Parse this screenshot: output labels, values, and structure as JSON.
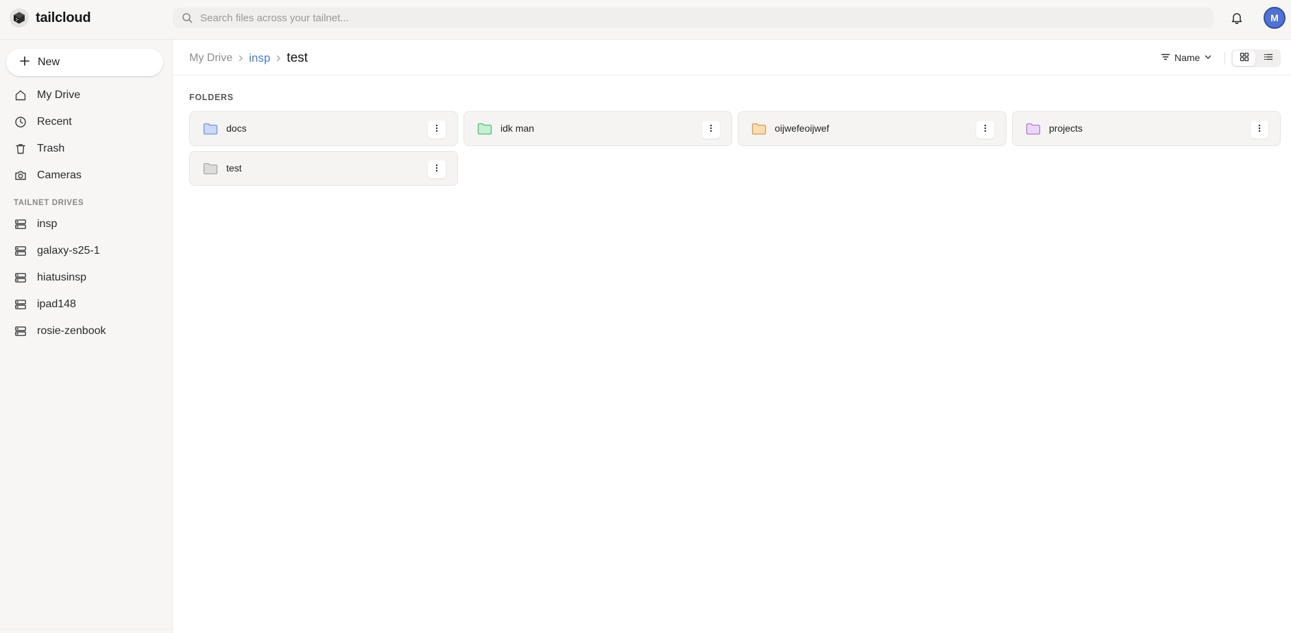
{
  "app": {
    "name": "tailcloud"
  },
  "search": {
    "placeholder": "Search files across your tailnet..."
  },
  "user": {
    "avatar_initial": "M",
    "avatar_color": "#4f72d6"
  },
  "sidebar": {
    "new_label": "New",
    "nav": [
      {
        "label": "My Drive",
        "icon": "home-icon"
      },
      {
        "label": "Recent",
        "icon": "clock-icon"
      },
      {
        "label": "Trash",
        "icon": "trash-icon"
      },
      {
        "label": "Cameras",
        "icon": "camera-icon"
      }
    ],
    "drives_heading": "TAILNET DRIVES",
    "drives": [
      {
        "label": "insp",
        "icon": "server-icon"
      },
      {
        "label": "galaxy-s25-1",
        "icon": "server-icon"
      },
      {
        "label": "hiatusinsp",
        "icon": "server-icon"
      },
      {
        "label": "ipad148",
        "icon": "server-icon"
      },
      {
        "label": "rosie-zenbook",
        "icon": "server-icon"
      }
    ]
  },
  "breadcrumb": {
    "root": "My Drive",
    "parent": "insp",
    "current": "test"
  },
  "toolbar": {
    "sort_label": "Name",
    "view_mode": "grid"
  },
  "folders": {
    "heading": "FOLDERS",
    "items": [
      {
        "name": "docs",
        "color": "#6f95e8",
        "fill": "#c9d9f7"
      },
      {
        "name": "idk man",
        "color": "#4fbf72",
        "fill": "#c7efd3"
      },
      {
        "name": "oijwefeoijwef",
        "color": "#e09a3c",
        "fill": "#f7dcb4"
      },
      {
        "name": "projects",
        "color": "#b07ad9",
        "fill": "#ead7f7"
      },
      {
        "name": "test",
        "color": "#a9a7a5",
        "fill": "#dedcda"
      }
    ]
  }
}
